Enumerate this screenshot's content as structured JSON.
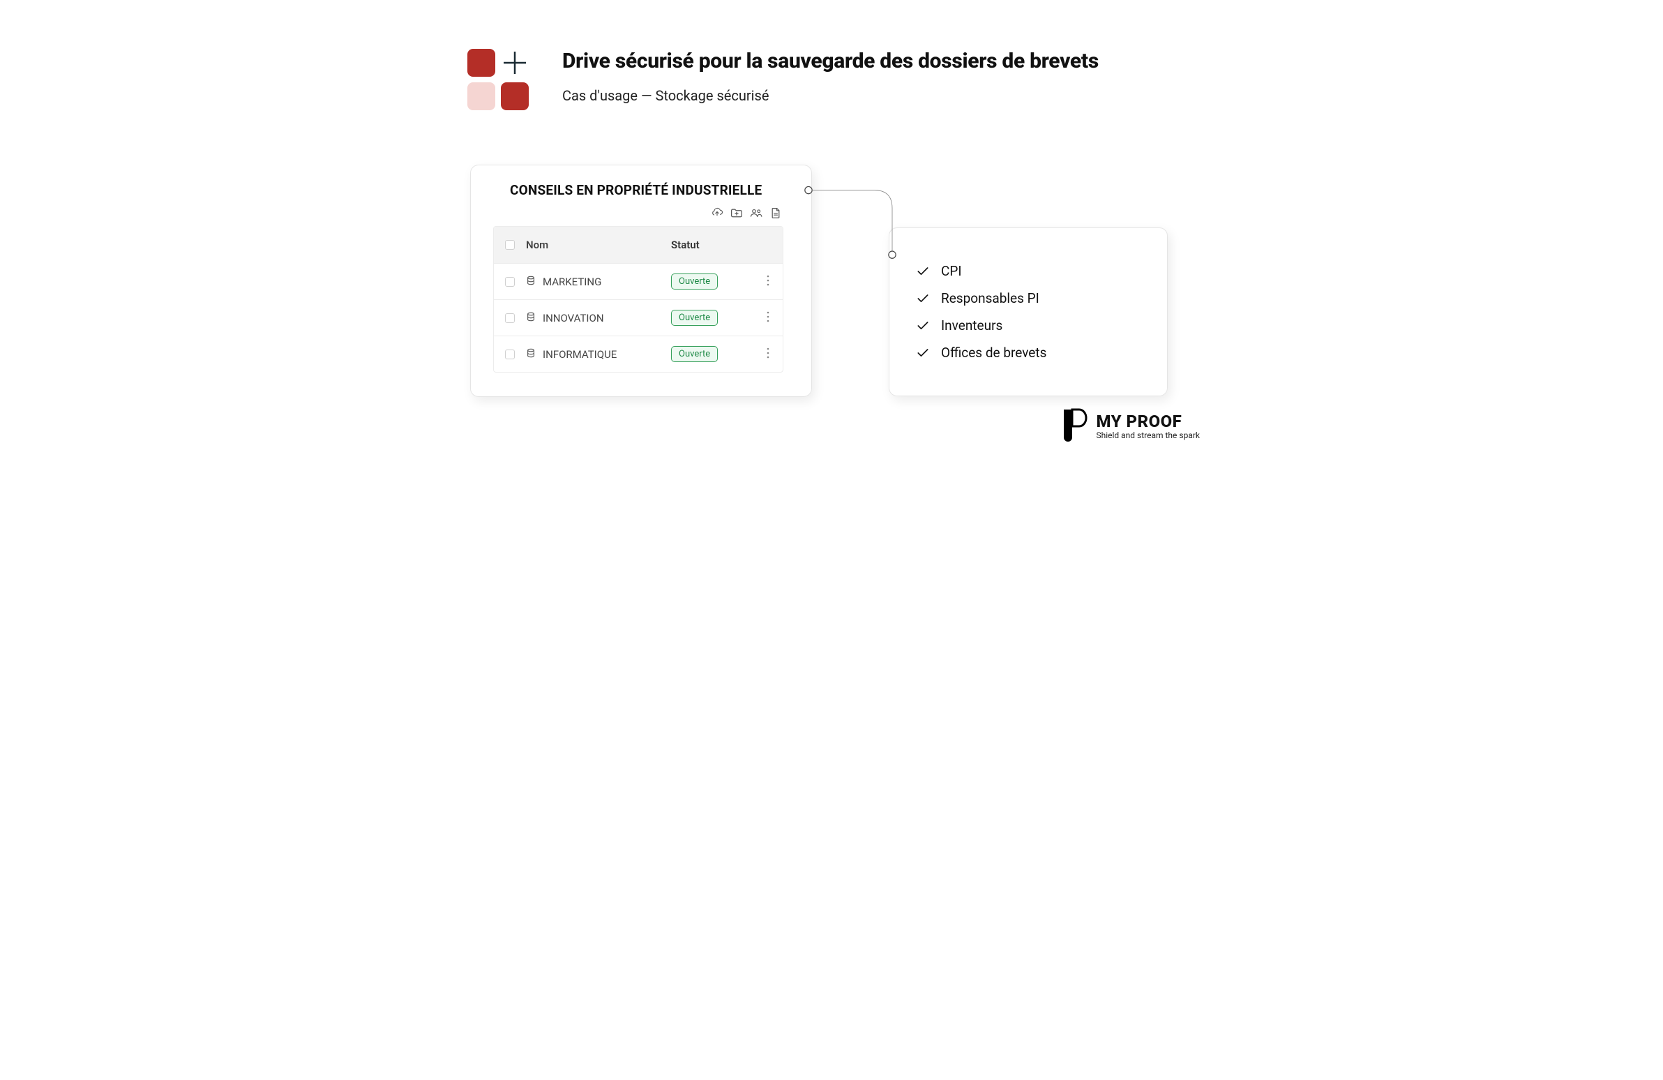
{
  "header": {
    "title": "Drive sécurisé pour la sauvegarde des dossiers de brevets",
    "subtitle": "Cas d'usage — Stockage sécurisé"
  },
  "table_card": {
    "title": "CONSEILS EN PROPRIÉTÉ INDUSTRIELLE",
    "columns": {
      "name": "Nom",
      "status": "Statut"
    },
    "rows": [
      {
        "name": "MARKETING",
        "status": "Ouverte"
      },
      {
        "name": "INNOVATION",
        "status": "Ouverte"
      },
      {
        "name": "INFORMATIQUE",
        "status": "Ouverte"
      }
    ]
  },
  "personas": {
    "items": [
      "CPI",
      "Responsables PI",
      "Inventeurs",
      "Offices de brevets"
    ]
  },
  "brand": {
    "name": "MY PROOF",
    "tagline": "Shield and stream the spark"
  }
}
